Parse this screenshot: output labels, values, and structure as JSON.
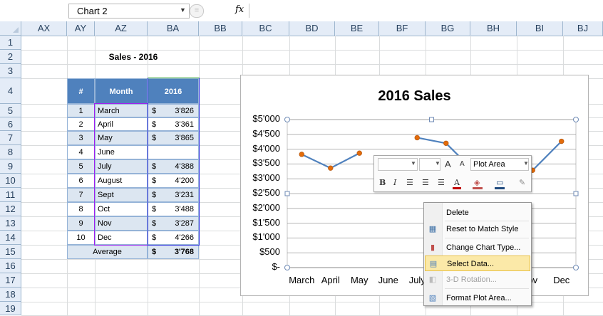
{
  "formula_bar": {
    "name_box": "Chart 2",
    "fx": "fx",
    "cancel": "="
  },
  "columns": [
    "AX",
    "AY",
    "AZ",
    "BA",
    "BB",
    "BC",
    "BD",
    "BE",
    "BF",
    "BG",
    "BH",
    "BI",
    "BJ"
  ],
  "rows": [
    "1",
    "2",
    "3",
    "4",
    "5",
    "6",
    "7",
    "8",
    "9",
    "10",
    "11",
    "12",
    "13",
    "14",
    "15",
    "16",
    "17",
    "18",
    "19"
  ],
  "sheet": {
    "title": "Sales - 2016",
    "headers": [
      "#",
      "Month",
      "2016"
    ],
    "currency": "$",
    "data": [
      {
        "n": "1",
        "month": "March",
        "value": "3'826"
      },
      {
        "n": "2",
        "month": "April",
        "value": "3'361"
      },
      {
        "n": "3",
        "month": "May",
        "value": "3'865"
      },
      {
        "n": "4",
        "month": "June",
        "value": ""
      },
      {
        "n": "5",
        "month": "July",
        "value": "4'388"
      },
      {
        "n": "6",
        "month": "August",
        "value": "4'200"
      },
      {
        "n": "7",
        "month": "Sept",
        "value": "3'231"
      },
      {
        "n": "8",
        "month": "Oct",
        "value": "3'488"
      },
      {
        "n": "9",
        "month": "Nov",
        "value": "3'287"
      },
      {
        "n": "10",
        "month": "Dec",
        "value": "4'266"
      }
    ],
    "average_label": "Average",
    "average_value": "3'768"
  },
  "chart_data": {
    "type": "line",
    "title": "2016 Sales",
    "y_tick_labels": [
      "$5'000",
      "$4'500",
      "$4'000",
      "$3'500",
      "$3'000",
      "$2'500",
      "$2'000",
      "$1'500",
      "$1'000",
      "$500",
      "$-"
    ],
    "ylim": [
      0,
      5000
    ],
    "x_tick_labels": [
      "March",
      "April",
      "May",
      "June",
      "July",
      "",
      "",
      "",
      "ov",
      "Dec"
    ],
    "categories": [
      "March",
      "April",
      "May",
      "June",
      "July",
      "August",
      "Sept",
      "Oct",
      "Nov",
      "Dec"
    ],
    "values": [
      3826,
      3361,
      3865,
      null,
      4388,
      4200,
      3231,
      3488,
      3287,
      4266
    ],
    "line_color": "#4f81bd",
    "marker_color": "#e46c0a"
  },
  "mini_toolbar": {
    "element_select": "Plot Area",
    "font": "",
    "size": "",
    "grow_font": "A",
    "shrink_font": "A",
    "bold": "B",
    "italic": "I",
    "font_color": "A"
  },
  "context_menu": [
    {
      "label": "Delete",
      "icon": "",
      "enabled": true
    },
    {
      "label": "Reset to Match Style",
      "icon": "reset-style-icon",
      "enabled": true
    },
    {
      "label": "Change Chart Type...",
      "icon": "chart-type-icon",
      "enabled": true
    },
    {
      "label": "Select Data...",
      "icon": "select-data-icon",
      "enabled": true,
      "highlighted": true
    },
    {
      "label": "3-D Rotation...",
      "icon": "rotation-icon",
      "enabled": false
    },
    {
      "label": "Format Plot Area...",
      "icon": "format-area-icon",
      "enabled": true
    }
  ]
}
